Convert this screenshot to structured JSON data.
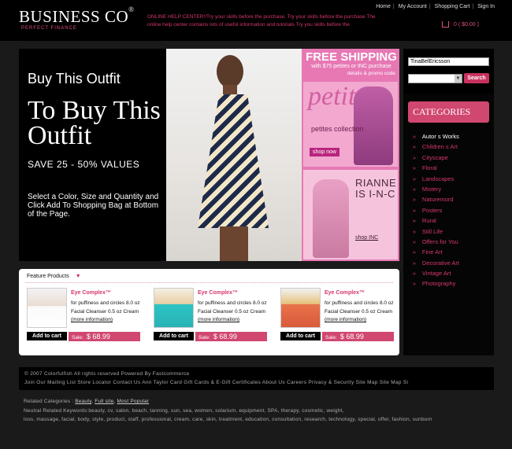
{
  "brand": {
    "name": "BUSINESS CO",
    "mark": "®",
    "tagline": "PERFECT FINANCE"
  },
  "help_text": "ONLINE HELP CENTER!!Try your skills before the purchase. Try your skills before the purchase The online help center contains lots of useful information and tutorials Try you skills before the",
  "top_links": [
    "Home",
    "My Account",
    "Shopping Cart",
    "Sign In"
  ],
  "cart_summary": "0  ( $0.00 )",
  "banner": {
    "buy_heading": "Buy This Outfit",
    "big_heading": "To Buy This Outfit",
    "save_text": "SAVE   25 - 50%  VALUES",
    "select_text": "Select a Color, Size and Quantity and Click Add To Shopping Bag at Bottom of the Page.",
    "free_shipping": "FREE SHIPPING",
    "shipping_sub": "with $75 petites or INC purchase",
    "details_link": "details & promo code",
    "petite_word": "petite",
    "petite_text": "petites collection",
    "petite_button": "shop now",
    "inc_word": "RIANNE IS I-N-C",
    "inc_button": "shop INC"
  },
  "login": {
    "username_value": "TinaBelEricsson"
  },
  "search": {
    "button_label": "Search"
  },
  "categories": {
    "heading": "CATEGORIES",
    "items": [
      "Autor s Works",
      "Children s Art",
      "Cityscape",
      "Floral",
      "Landscapes",
      "Mistery",
      "Naturemord",
      "Posters",
      "Rural",
      "Still Life",
      "Offers for You",
      "Fine Art",
      "Decorative Art",
      "Vintage Art",
      "Photography"
    ]
  },
  "features": {
    "title": "Feature  Products",
    "products": [
      {
        "title": "Eye Complex™",
        "desc": "for puffiness and circles 8.0 oz Facial Cleanser 0.5 oz Cream",
        "more": "(more information)",
        "add_label": "Add to cart",
        "sale_label": "Sale:",
        "price": "$ 68.99"
      },
      {
        "title": "Eye Complex™",
        "desc": "for puffiness and circles 8.0 oz Facial Cleanser 0.5 oz Cream",
        "more": "(more information)",
        "add_label": "Add to cart",
        "sale_label": "Sale:",
        "price": "$ 68.99"
      },
      {
        "title": "Eye Complex™",
        "desc": "for puffiness and circles 8.0 oz Facial Cleanser 0.5 oz Cream",
        "more": "(more information)",
        "add_label": "Add to cart",
        "sale_label": "Sale:",
        "price": "$ 68.99"
      }
    ]
  },
  "footer": {
    "copyright": "© 2007 Colorfulfish All rights reserved Powered  By Fastcommerce",
    "links": "Join Our Mailing List  Store Locator Contact Us Ann Taylor Card Gift Cards & E-Gift Certificates About Us Careers Privacy & Security Site Map Site Map Si"
  },
  "related": {
    "categories_prefix": "Related Categories : ",
    "categories": [
      "Beauty",
      "Full site",
      "Most Popular"
    ],
    "keywords_line1": "Neutral  Related Keywords:beauty, cv, salon, beach, tanning, sun, sea, women, solarium, equipment, SPA, therapy, cosmetic, weight,",
    "keywords_line2": "loss, massage, facial, body, style, product, staff, professional, cream, care, skin, treatment, education, consultation, research, technology, special, offer, fashion, sunburn"
  },
  "colors": {
    "accent": "#d6386a",
    "background": "#1a1a1a",
    "panel": "#000000",
    "shipping_pink": "#e778b4"
  }
}
